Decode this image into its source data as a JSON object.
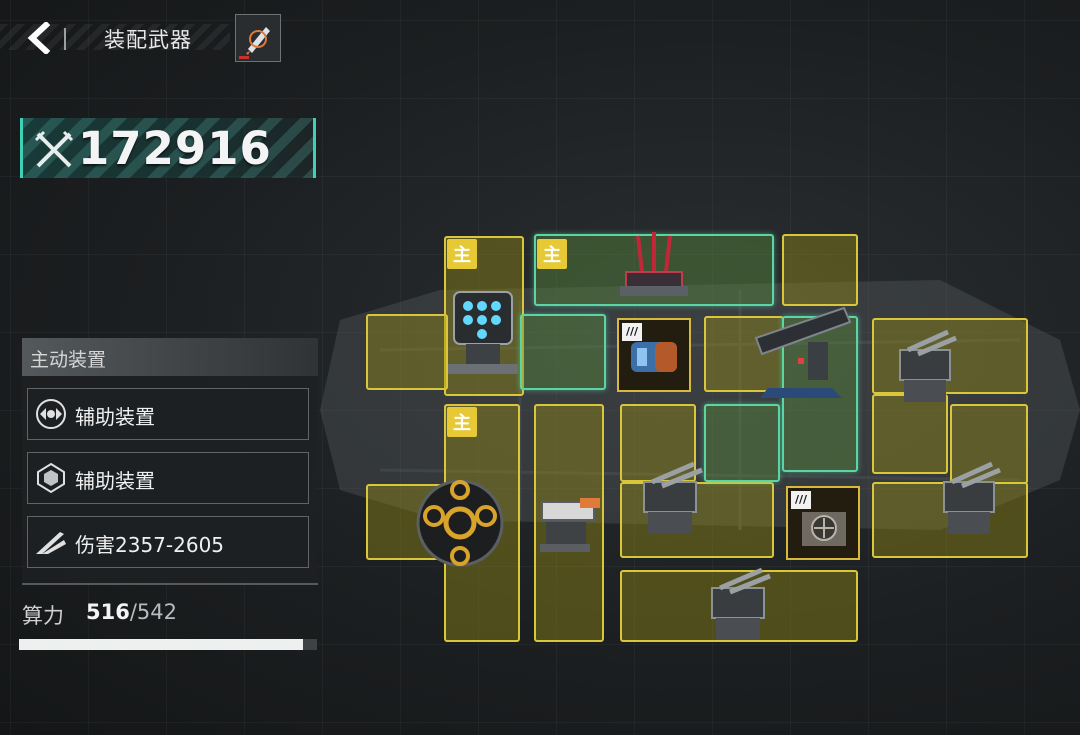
{
  "header": {
    "title": "装配武器",
    "back_icon": "chevron-left-icon",
    "ship_icon": "ship-icon"
  },
  "power": {
    "icon": "crossed-swords-icon",
    "value": "172916"
  },
  "active_panel": {
    "title": "主动装置",
    "items": [
      {
        "label": "辅助装置",
        "icon": "shield-emblem-icon"
      },
      {
        "label": "辅助装置",
        "icon": "spiked-shield-icon"
      },
      {
        "label": "伤害2357-2605",
        "icon": "damage-claw-icon"
      }
    ]
  },
  "compute": {
    "label": "算力",
    "used": "516",
    "separator": "/",
    "total": "542",
    "fraction": 0.952
  },
  "grid": {
    "main_badge": "主",
    "card_tag": "///"
  },
  "colors": {
    "slot_border": "#d9c63b",
    "slot_glow": "#59d6a4",
    "power_accent": "#3fd1b6",
    "badge": "#e6c935"
  }
}
